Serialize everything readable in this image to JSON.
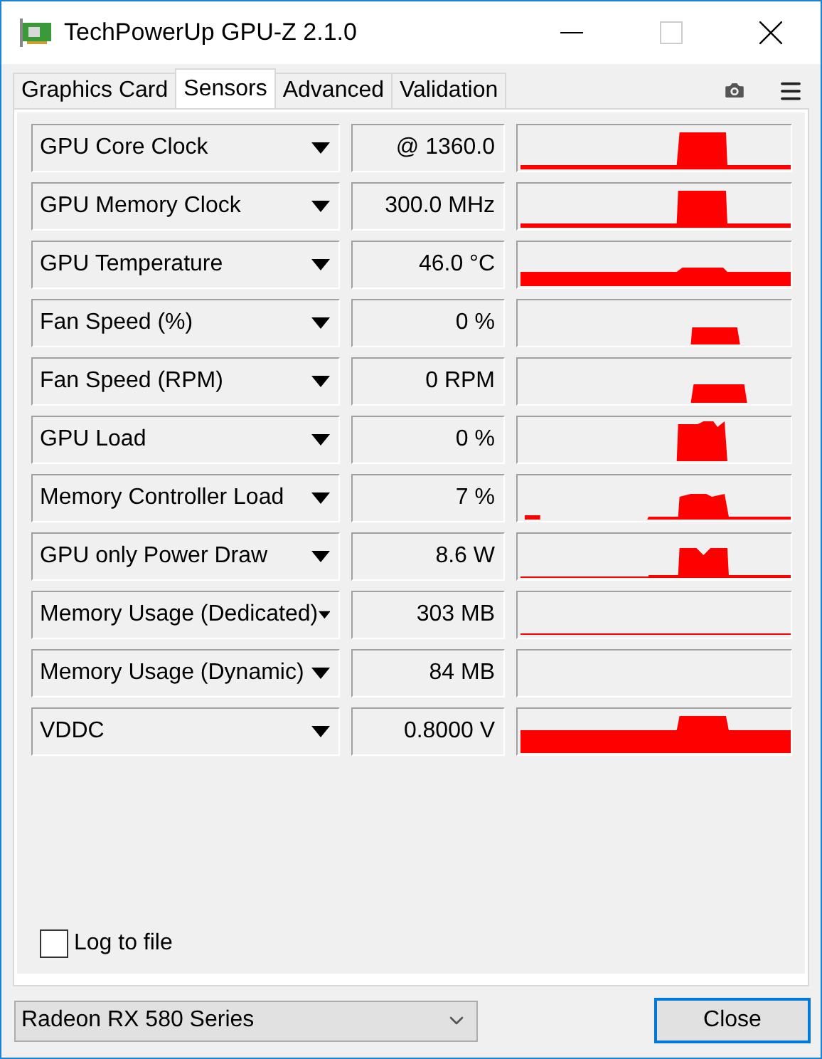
{
  "window": {
    "title": "TechPowerUp GPU-Z 2.1.0"
  },
  "tabs": [
    {
      "label": "Graphics Card",
      "selected": false
    },
    {
      "label": "Sensors",
      "selected": true
    },
    {
      "label": "Advanced",
      "selected": false
    },
    {
      "label": "Validation",
      "selected": false
    }
  ],
  "sensors": [
    {
      "name": "GPU Core Clock",
      "value": "@ 1360.0"
    },
    {
      "name": "GPU Memory Clock",
      "value": "300.0 MHz"
    },
    {
      "name": "GPU Temperature",
      "value": "46.0 °C"
    },
    {
      "name": "Fan Speed (%)",
      "value": "0 %"
    },
    {
      "name": "Fan Speed (RPM)",
      "value": "0 RPM"
    },
    {
      "name": "GPU Load",
      "value": "0 %"
    },
    {
      "name": "Memory Controller Load",
      "value": "7 %"
    },
    {
      "name": "GPU only Power Draw",
      "value": "8.6 W"
    },
    {
      "name": "Memory Usage (Dedicated)",
      "value": "303 MB"
    },
    {
      "name": "Memory Usage (Dynamic)",
      "value": "84 MB"
    },
    {
      "name": "VDDC",
      "value": "0.8000 V"
    }
  ],
  "log_to_file": {
    "label": "Log to file",
    "checked": false
  },
  "gpu_select": {
    "value": "Radeon RX 580 Series"
  },
  "buttons": [
    {
      "label": "Close",
      "focused": true
    }
  ]
}
